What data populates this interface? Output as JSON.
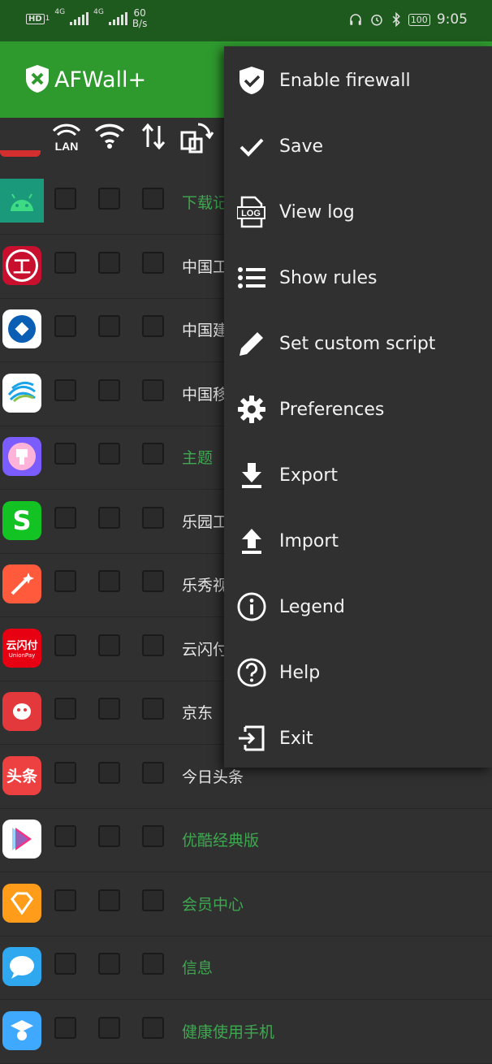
{
  "status_bar": {
    "hd_badge": "HD",
    "sim1_label": "1",
    "network1": "4G",
    "network2": "4G",
    "speed_value": "60",
    "speed_unit": "B/s",
    "battery": "100",
    "time": "9:05"
  },
  "app_bar": {
    "title": "AFWall+"
  },
  "column_header": {
    "lan_label": "LAN"
  },
  "apps": [
    {
      "name": "下载记录",
      "highlight": true,
      "icon": "android-icon",
      "bg": "#1a9a7a"
    },
    {
      "name": "中国工商银行",
      "highlight": false,
      "icon": "icbc-icon",
      "bg": "#c8102e"
    },
    {
      "name": "中国建设银行",
      "highlight": false,
      "icon": "ccb-icon",
      "bg": "#ffffff"
    },
    {
      "name": "中国移动",
      "highlight": false,
      "icon": "china-mobile-icon",
      "bg": "#ffffff"
    },
    {
      "name": "主题",
      "highlight": true,
      "icon": "theme-icon",
      "bg": "#7b5cff"
    },
    {
      "name": "乐园工具",
      "highlight": false,
      "icon": "s-icon",
      "bg": "#12c323"
    },
    {
      "name": "乐秀视频",
      "highlight": false,
      "icon": "magic-wand-icon",
      "bg": "#ff5a3c"
    },
    {
      "name": "云闪付",
      "highlight": false,
      "icon": "unionpay-icon",
      "bg": "#e60012"
    },
    {
      "name": "京东",
      "highlight": false,
      "icon": "jd-icon",
      "bg": "#e4393c"
    },
    {
      "name": "今日头条",
      "highlight": false,
      "icon": "toutiao-icon",
      "bg": "#ed4040"
    },
    {
      "name": "优酷经典版",
      "highlight": true,
      "icon": "youku-icon",
      "bg": "#ffffff"
    },
    {
      "name": "会员中心",
      "highlight": true,
      "icon": "vip-icon",
      "bg": "#ff9c1a"
    },
    {
      "name": "信息",
      "highlight": true,
      "icon": "message-icon",
      "bg": "#30a8f0"
    },
    {
      "name": "健康使用手机",
      "highlight": true,
      "icon": "health-icon",
      "bg": "#3fa8ff"
    }
  ],
  "app_icon_text": {
    "s": "S",
    "unionpay": "云闪付",
    "unionpay_sub": "UnionPay",
    "toutiao": "头条",
    "icbc": "工"
  },
  "menu": {
    "items": [
      {
        "label": "Enable firewall",
        "icon": "shield-check-icon"
      },
      {
        "label": "Save",
        "icon": "check-icon"
      },
      {
        "label": "View log",
        "icon": "log-file-icon"
      },
      {
        "label": "Show rules",
        "icon": "list-icon"
      },
      {
        "label": "Set custom script",
        "icon": "pencil-icon"
      },
      {
        "label": "Preferences",
        "icon": "gear-icon"
      },
      {
        "label": "Export",
        "icon": "download-icon"
      },
      {
        "label": "Import",
        "icon": "upload-icon"
      },
      {
        "label": "Legend",
        "icon": "info-icon"
      },
      {
        "label": "Help",
        "icon": "help-icon"
      },
      {
        "label": "Exit",
        "icon": "exit-icon"
      }
    ],
    "log_icon_text": "LOG"
  },
  "colors": {
    "status_bar": "#1e5a1e",
    "app_bar": "#2e9a2e",
    "background": "#303030",
    "highlight_text": "#3ea850"
  }
}
